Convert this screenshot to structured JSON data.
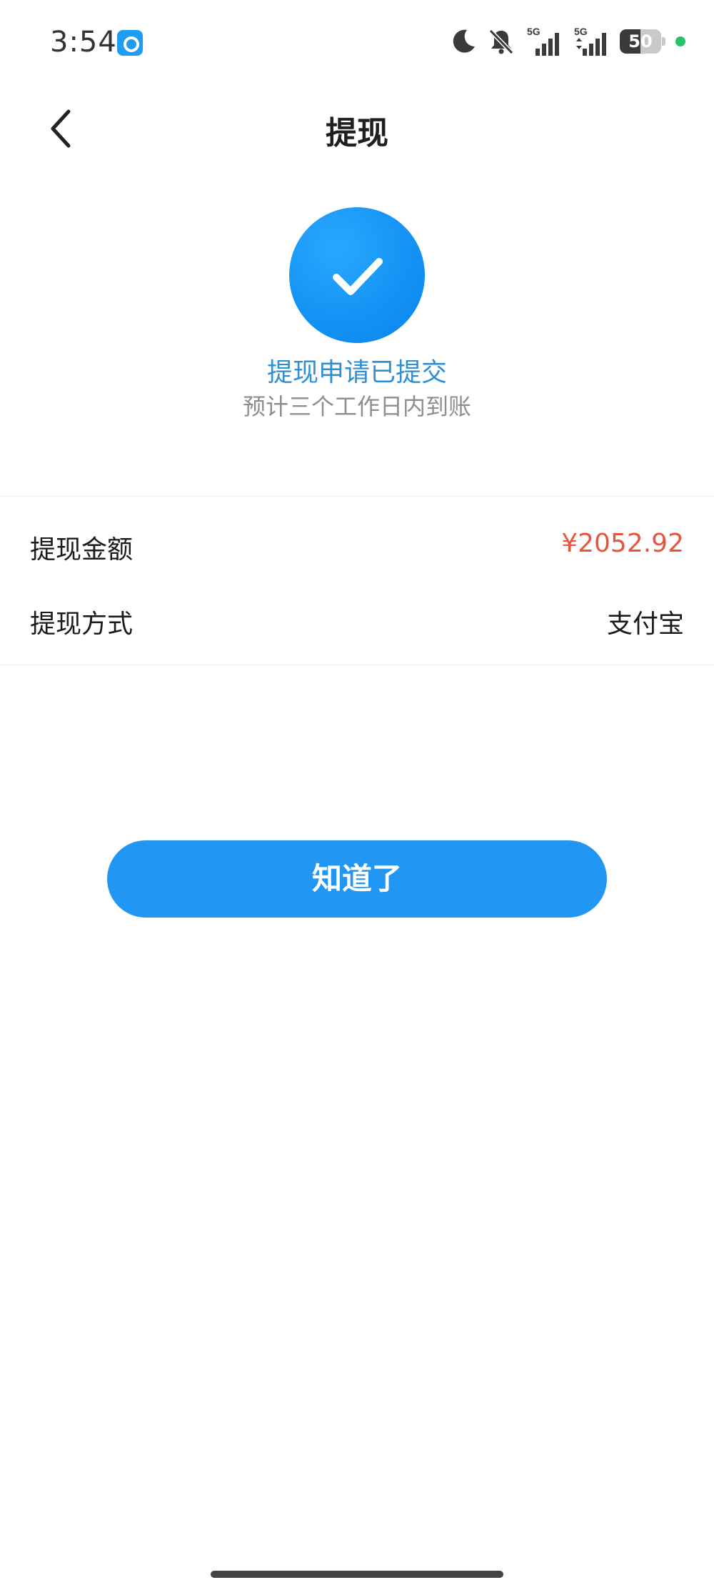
{
  "status_bar": {
    "time": "3:54",
    "network_1": "5G",
    "network_2": "5G",
    "battery_percent": "50",
    "battery_level": 0.5,
    "dot_color": "#27c46c"
  },
  "header": {
    "title": "提现"
  },
  "success": {
    "title": "提现申请已提交",
    "subtitle": "预计三个工作日内到账",
    "accent_color": "#1493f5"
  },
  "details": [
    {
      "label": "提现金额",
      "value": "¥2052.92"
    },
    {
      "label": "提现方式",
      "value": "支付宝"
    }
  ],
  "button": {
    "label": "知道了",
    "color": "#2196f3"
  },
  "colors": {
    "amount": "#e6563f"
  }
}
